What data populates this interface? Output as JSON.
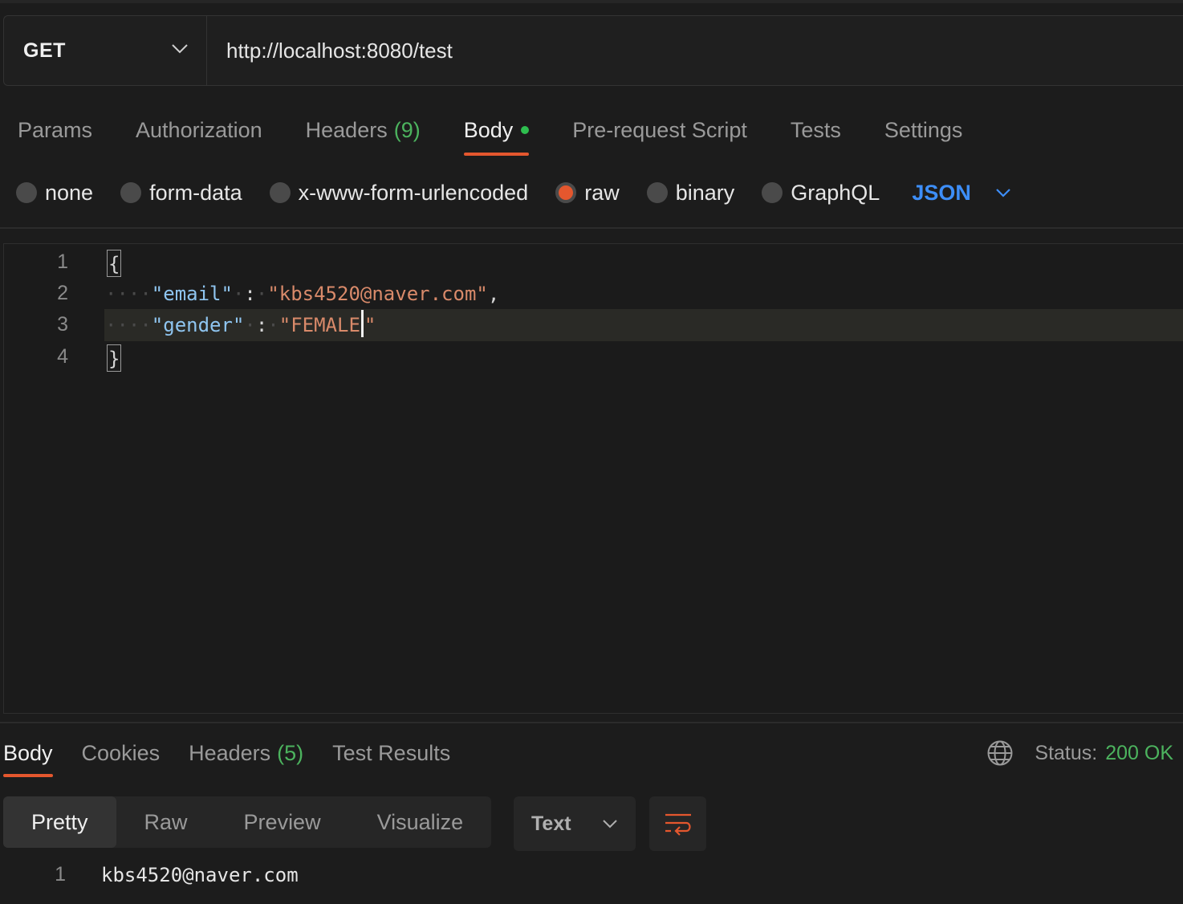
{
  "request": {
    "method": "GET",
    "url": "http://localhost:8080/test"
  },
  "request_tabs": [
    {
      "label": "Params"
    },
    {
      "label": "Authorization"
    },
    {
      "label": "Headers",
      "count": "(9)"
    },
    {
      "label": "Body"
    },
    {
      "label": "Pre-request Script"
    },
    {
      "label": "Tests"
    },
    {
      "label": "Settings"
    }
  ],
  "body_types": [
    {
      "label": "none"
    },
    {
      "label": "form-data"
    },
    {
      "label": "x-www-form-urlencoded"
    },
    {
      "label": "raw"
    },
    {
      "label": "binary"
    },
    {
      "label": "GraphQL"
    }
  ],
  "body_format": "JSON",
  "editor": {
    "line_numbers": [
      "1",
      "2",
      "3",
      "4"
    ],
    "open_brace": "{",
    "close_brace": "}",
    "line2": {
      "indent": "····",
      "key": "\"email\"",
      "sep1": "·",
      "colon": ":",
      "sep2": "·",
      "value": "\"kbs4520@naver.com\"",
      "comma": ","
    },
    "line3": {
      "indent": "····",
      "key": "\"gender\"",
      "sep1": "·",
      "colon": ":",
      "sep2": "·",
      "value_before_cursor": "\"FEMALE",
      "value_after_cursor": "\""
    }
  },
  "response": {
    "tabs": [
      {
        "label": "Body"
      },
      {
        "label": "Cookies"
      },
      {
        "label": "Headers",
        "count": "(5)"
      },
      {
        "label": "Test Results"
      }
    ],
    "status_label": "Status:",
    "status_value": "200 OK",
    "view_modes": [
      {
        "label": "Pretty"
      },
      {
        "label": "Raw"
      },
      {
        "label": "Preview"
      },
      {
        "label": "Visualize"
      }
    ],
    "format_select": "Text",
    "body_line_number": "1",
    "body_text": "kbs4520@naver.com"
  },
  "colors": {
    "accent": "#e4572e",
    "format_blue": "#3d8ef8",
    "status_green": "#4cb35e",
    "modified_dot": "#2ebe4f"
  }
}
